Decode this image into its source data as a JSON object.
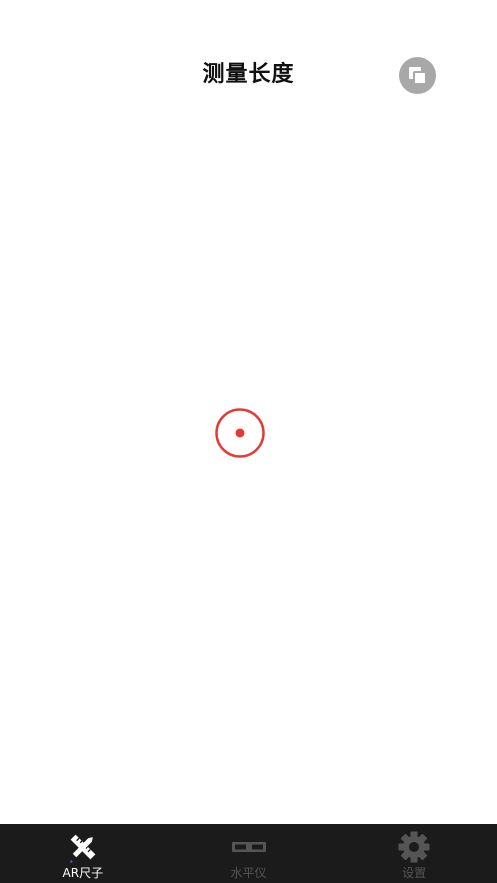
{
  "header": {
    "title": "测量长度"
  },
  "colors": {
    "reticle": "#e53935",
    "tabbar_bg": "#1b1b1b",
    "tab_active": "#ffffff",
    "tab_inactive": "#555555",
    "copy_button_bg": "#a8a8a8"
  },
  "icons": {
    "copy_button": "copy-icon",
    "reticle": "target-reticle-icon"
  },
  "tabs": [
    {
      "label": "AR尺子",
      "icon": "ruler-pencil-icon",
      "active": true
    },
    {
      "label": "水平仪",
      "icon": "level-icon",
      "active": false
    },
    {
      "label": "设置",
      "icon": "gear-icon",
      "active": false
    }
  ]
}
